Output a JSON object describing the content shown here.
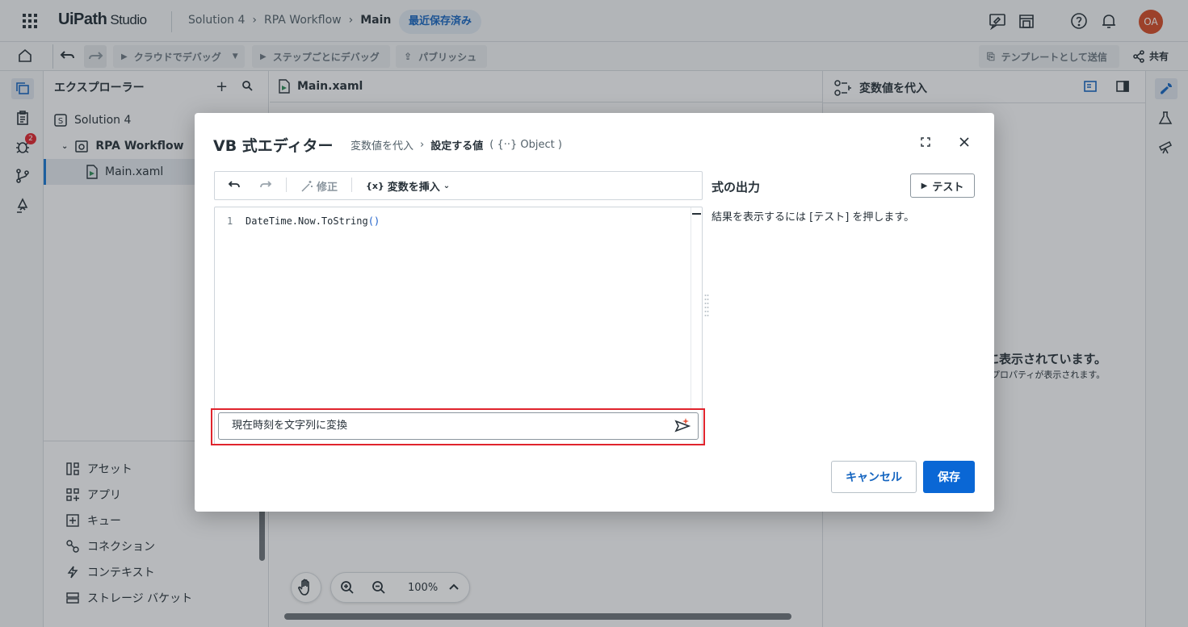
{
  "header": {
    "logo_brand": "UiPath",
    "logo_product": "Studio",
    "breadcrumb": [
      "Solution 4",
      "RPA Workflow",
      "Main"
    ],
    "saved_status": "最近保存済み",
    "avatar_initials": "OA"
  },
  "toolbar": {
    "debug_cloud": "クラウドでデバッグ",
    "debug_step": "ステップごとにデバッグ",
    "publish": "パブリッシュ",
    "send_template": "テンプレートとして送信",
    "share": "共有"
  },
  "activity_badge": "2",
  "explorer": {
    "title": "エクスプローラー",
    "tree": [
      {
        "label": "Solution 4"
      },
      {
        "label": "RPA Workflow"
      },
      {
        "label": "Main.xaml"
      }
    ],
    "resources": [
      "アセット",
      "アプリ",
      "キュー",
      "コネクション",
      "コンテキスト",
      "ストレージ バケット"
    ]
  },
  "canvas": {
    "tab": "Main.xaml",
    "zoom": "100%"
  },
  "properties": {
    "title": "変数値を代入",
    "msg_main": "に表示されています。",
    "msg_sub": "プロパティが表示されます。"
  },
  "dialog": {
    "title": "VB 式エディター",
    "crumb_activity": "変数値を代入",
    "crumb_field": "設定する値",
    "crumb_type": "( {··} Object )",
    "fix_label": "修正",
    "insert_var_label": "変数を挿入",
    "insert_var_icon_text": "{x}",
    "line_number": "1",
    "code_main": "DateTime.Now.ToString",
    "code_parens": "()",
    "prompt_text": "現在時刻を文字列に変換",
    "output_title": "式の出力",
    "output_hint": "結果を表示するには [テスト] を押します。",
    "test_label": "テスト",
    "cancel_label": "キャンセル",
    "save_label": "保存"
  },
  "colors": {
    "accent": "#0a67d5",
    "badge_red": "#e0242d",
    "avatar": "#d34b25",
    "highlight_frame": "#e0242d"
  }
}
